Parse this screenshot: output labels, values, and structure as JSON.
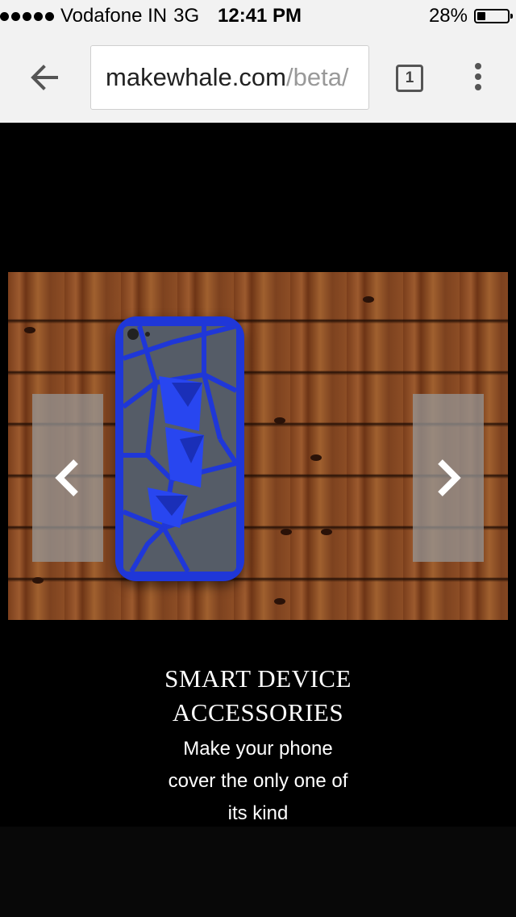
{
  "status_bar": {
    "carrier": "Vodafone IN",
    "network": "3G",
    "time": "12:41 PM",
    "battery_percent": "28%",
    "battery_level": 0.28,
    "signal_dots": 5
  },
  "browser": {
    "url_host": "makewhale.com",
    "url_path": "/beta/",
    "tab_count": "1",
    "icons": [
      "back-arrow-icon",
      "tabs-icon",
      "overflow-menu-icon"
    ]
  },
  "carousel": {
    "image_subject": "blue 3D-printed geometric phone case on wood",
    "prev_icon": "chevron-left-icon",
    "next_icon": "chevron-right-icon"
  },
  "caption": {
    "title_line1": "SMART DEVICE",
    "title_line2": "ACCESSORIES",
    "subtitle_line1": "Make your phone",
    "subtitle_line2": "cover the only one of",
    "subtitle_line3": "its kind"
  },
  "colors": {
    "chrome_bg": "#f2f2f2",
    "page_bg": "#000000",
    "case_blue": "#1f37d8",
    "arrow_bg": "#969696"
  }
}
